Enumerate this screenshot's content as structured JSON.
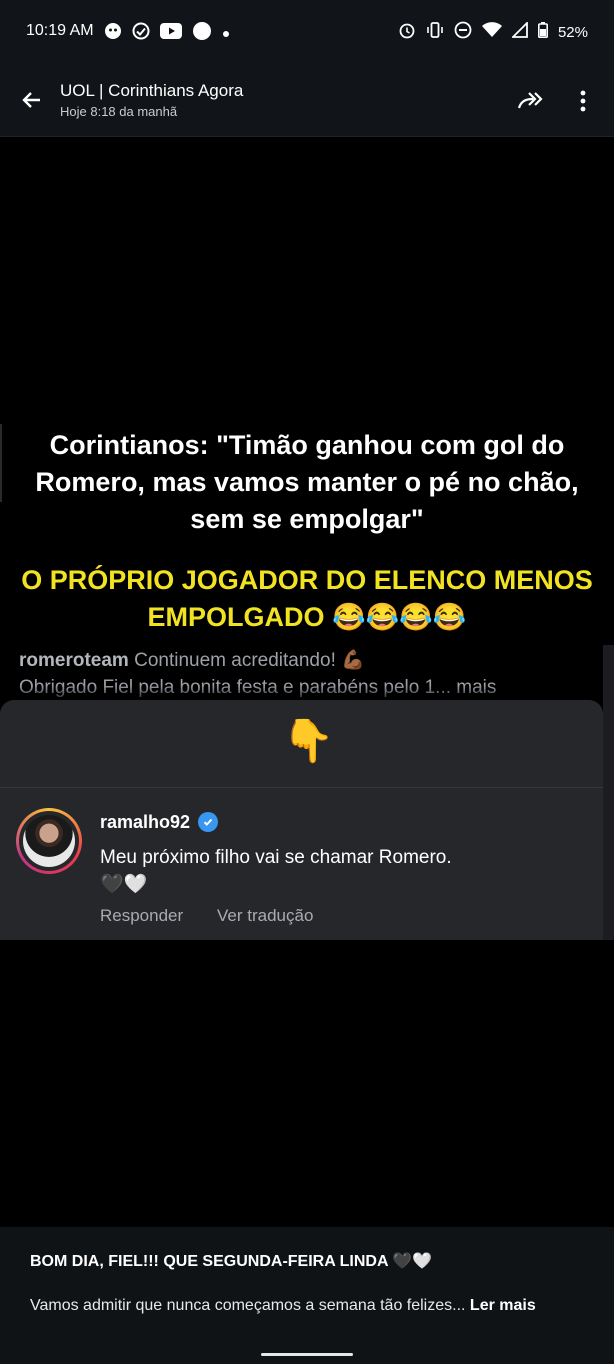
{
  "status_bar": {
    "time": "10:19 AM",
    "battery": "52%"
  },
  "header": {
    "title": "UOL | Corinthians Agora",
    "subtitle": "Hoje 8:18 da manhã"
  },
  "post": {
    "headline": "Corintianos: \"Timão ganhou com gol do Romero, mas vamos manter o pé no chão, sem se empolgar\"",
    "highlight": "O PRÓPRIO JOGADOR DO ELENCO MENOS EMPOLGADO 😂😂😂😂",
    "embedded_caption": {
      "user": "romeroteam",
      "line1": "Continuem acreditando! 💪🏾",
      "line2": "Obrigado Fiel pela bonita festa e parabéns pelo 1... mais"
    },
    "pointer_emoji": "👇",
    "comment": {
      "username": "ramalho92",
      "text": "Meu próximo filho vai se chamar Romero.",
      "hearts": "🖤🤍",
      "reply_label": "Responder",
      "translate_label": "Ver tradução"
    }
  },
  "caption": {
    "title": "BOM DIA, FIEL!!! QUE SEGUNDA-FEIRA LINDA 🖤🤍",
    "body": "Vamos admitir que nunca começamos a semana tão felizes...",
    "read_more": "Ler mais"
  }
}
